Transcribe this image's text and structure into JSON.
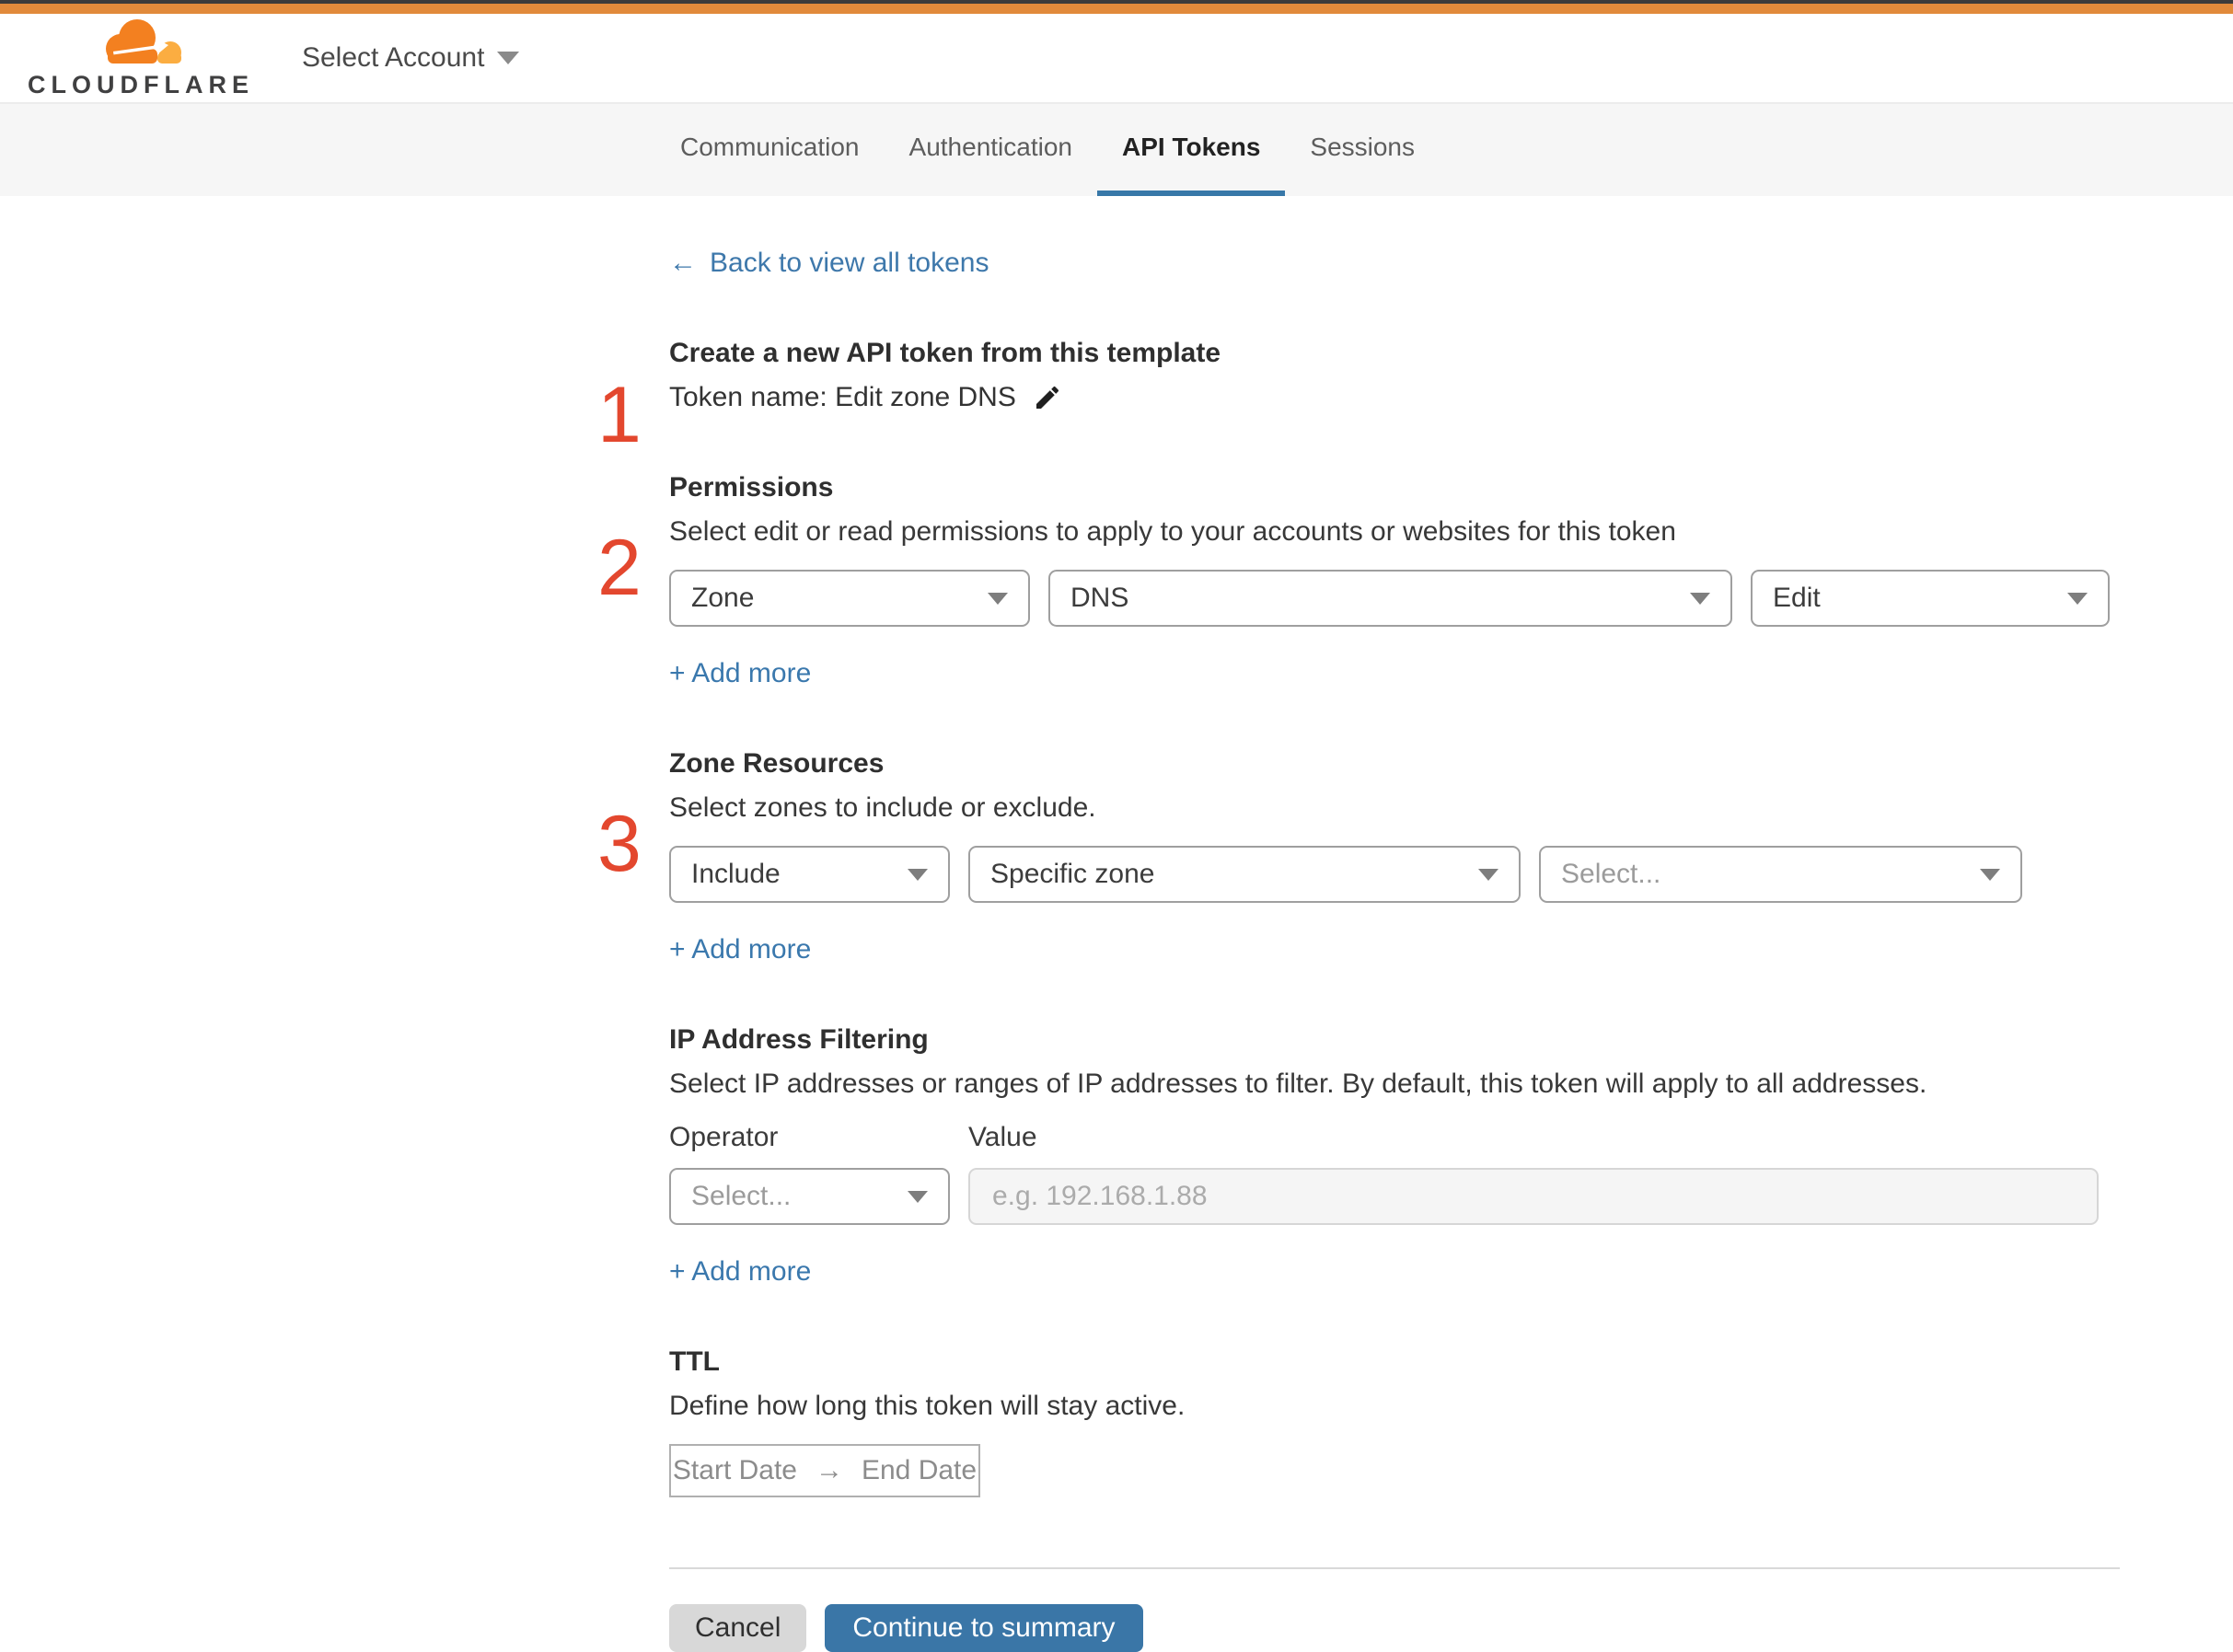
{
  "header": {
    "logo_text": "CLOUDFLARE",
    "account_selector": "Select Account"
  },
  "tabs": [
    {
      "label": "Communication",
      "active": false
    },
    {
      "label": "Authentication",
      "active": false
    },
    {
      "label": "API Tokens",
      "active": true
    },
    {
      "label": "Sessions",
      "active": false
    }
  ],
  "back_link": {
    "arrow": "←",
    "label": "Back to view all tokens"
  },
  "steps": {
    "one": "1",
    "two": "2",
    "three": "3"
  },
  "token_section": {
    "title": "Create a new API token from this template",
    "token_name_label": "Token name: Edit zone DNS"
  },
  "permissions": {
    "title": "Permissions",
    "description": "Select edit or read permissions to apply to your accounts or websites for this token",
    "scope_value": "Zone",
    "resource_value": "DNS",
    "access_value": "Edit",
    "add_more": "+ Add more"
  },
  "zone_resources": {
    "title": "Zone Resources",
    "description": "Select zones to include or exclude.",
    "mode_value": "Include",
    "type_value": "Specific zone",
    "zone_placeholder": "Select...",
    "add_more": "+ Add more"
  },
  "ip_filtering": {
    "title": "IP Address Filtering",
    "description": "Select IP addresses or ranges of IP addresses to filter. By default, this token will apply to all addresses.",
    "operator_label": "Operator",
    "value_label": "Value",
    "operator_placeholder": "Select...",
    "value_placeholder": "e.g. 192.168.1.88",
    "add_more": "+ Add more"
  },
  "ttl": {
    "title": "TTL",
    "description": "Define how long this token will stay active.",
    "start_label": "Start Date",
    "arrow": "→",
    "end_label": "End Date"
  },
  "actions": {
    "cancel": "Cancel",
    "continue": "Continue to summary"
  },
  "colors": {
    "brand_orange": "#e18a3b",
    "link_blue": "#3a77a8",
    "step_red": "#e3472e",
    "primary_button": "#3a76a7"
  }
}
